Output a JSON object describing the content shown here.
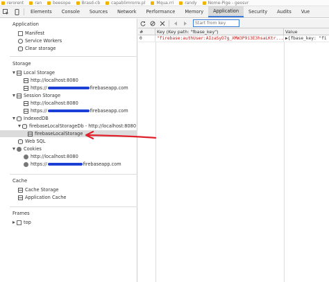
{
  "bookmarks": [
    "rerorent",
    "ran",
    "beesope",
    "Brasd-cb",
    "capablimrorre.pl",
    "Mqua.rri",
    "randy",
    "Nome-Pige - geosvr"
  ],
  "devtools": {
    "tabs": [
      {
        "label": "Elements"
      },
      {
        "label": "Console"
      },
      {
        "label": "Sources"
      },
      {
        "label": "Network"
      },
      {
        "label": "Performance"
      },
      {
        "label": "Memory"
      },
      {
        "label": "Application",
        "active": true
      },
      {
        "label": "Security"
      },
      {
        "label": "Audits"
      },
      {
        "label": "Vue"
      }
    ]
  },
  "sidebar": {
    "application": {
      "title": "Application",
      "items": [
        "Manifest",
        "Service Workers",
        "Clear storage"
      ]
    },
    "storage": {
      "title": "Storage",
      "local_storage": {
        "label": "Local Storage",
        "children": [
          "http://localhost:8080",
          "https://",
          "firebaseapp.com"
        ]
      },
      "session_storage": {
        "label": "Session Storage",
        "children": [
          "http://localhost:8080",
          "https://",
          "firebaseapp.com"
        ]
      },
      "indexeddb": {
        "label": "IndexedDB",
        "db": "firebaseLocalStorageDb - http://localhost:8080",
        "store": "firebaseLocalStorage"
      },
      "web_sql": "Web SQL",
      "cookies": {
        "label": "Cookies",
        "children": [
          "http://localhost:8080",
          "https://",
          "firebaseapp.com"
        ]
      }
    },
    "cache": {
      "title": "Cache",
      "items": [
        "Cache Storage",
        "Application Cache"
      ]
    },
    "frames": {
      "title": "Frames",
      "items": [
        "top"
      ]
    }
  },
  "main": {
    "search_placeholder": "Start from key",
    "columns": [
      "#",
      "Key (Key path: \"fbase_key\")",
      "Value"
    ],
    "rows": [
      {
        "index": "0",
        "key": "\"firebase:authUser:AIzaSyD7g_XMW3P9i3E3hsaLKtr...",
        "value": "▶{fbase_key: \"fi"
      }
    ]
  },
  "colors": {
    "accent": "#3879d9",
    "annotation_arrow": "#e0202a",
    "redaction": "#1c3fd6",
    "key_text": "#c41a16"
  }
}
